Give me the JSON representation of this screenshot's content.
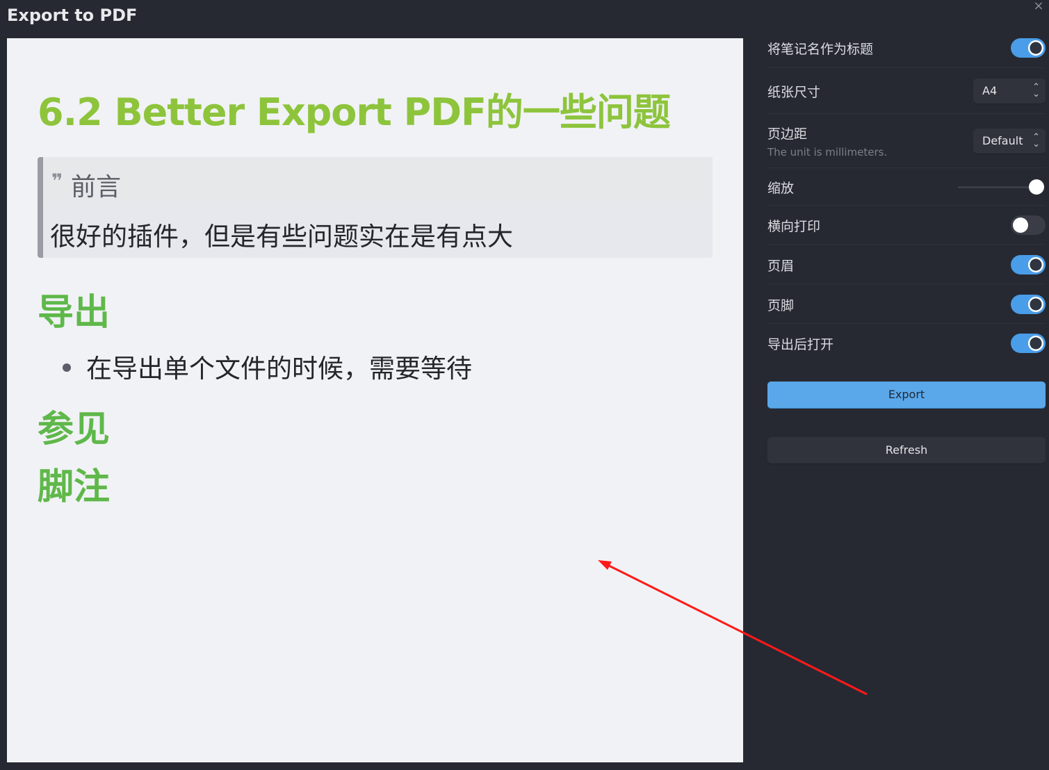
{
  "window": {
    "title": "Export to PDF",
    "close_icon": "×"
  },
  "preview": {
    "doc_title": "6.2 Better Export PDF的一些问题",
    "callout": {
      "icon": "quote-icon",
      "icon_glyph": "❞",
      "title": "前言",
      "body": "很好的插件，但是有些问题实在是有点大"
    },
    "sections": [
      {
        "heading": "导出",
        "bullets": [
          "在导出单个文件的时候，需要等待"
        ]
      },
      {
        "heading": "参见"
      },
      {
        "heading": "脚注"
      }
    ]
  },
  "settings": {
    "note_name_as_title": {
      "label": "将笔记名作为标题",
      "on": true
    },
    "paper_size": {
      "label": "纸张尺寸",
      "value": "A4"
    },
    "margin": {
      "label": "页边距",
      "desc": "The unit is millimeters.",
      "value": "Default"
    },
    "scale": {
      "label": "缩放",
      "level": 1.0
    },
    "landscape": {
      "label": "横向打印",
      "on": false
    },
    "header": {
      "label": "页眉",
      "on": true
    },
    "footer": {
      "label": "页脚",
      "on": true
    },
    "open_after_export": {
      "label": "导出后打开",
      "on": true
    }
  },
  "buttons": {
    "export": "Export",
    "refresh": "Refresh"
  },
  "colors": {
    "accent": "#4a9de8",
    "title_green": "#8dc43c",
    "heading_green": "#5fb84a",
    "annotation_arrow": "#ff1a1a"
  }
}
